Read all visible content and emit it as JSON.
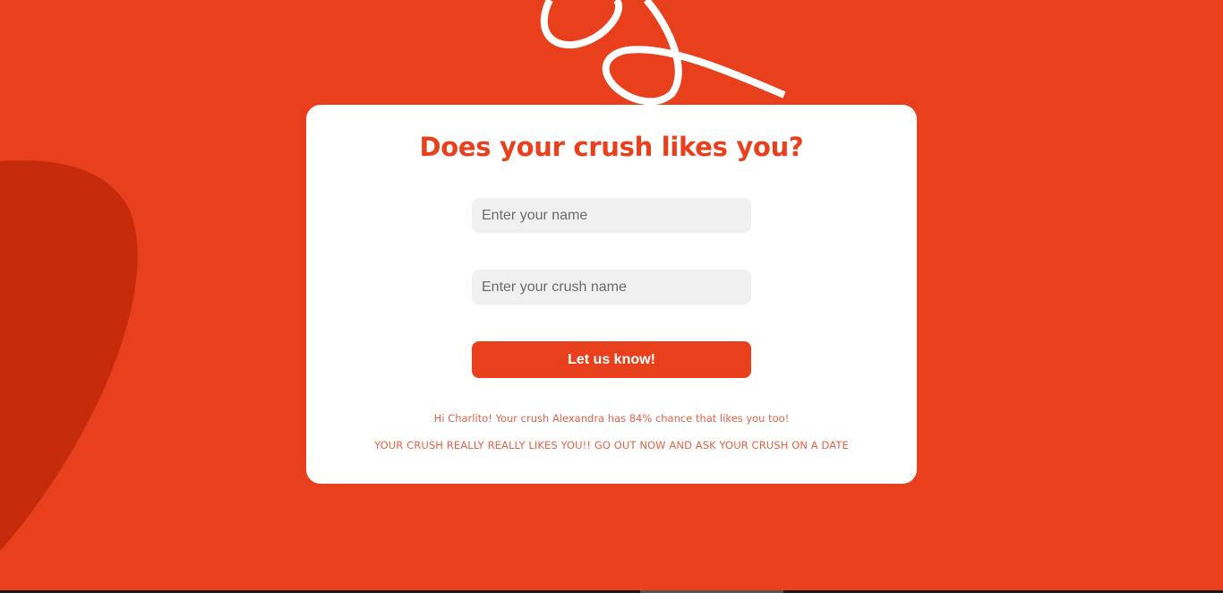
{
  "page": {
    "background_color": "#e8401c",
    "accent_color": "#e8401c",
    "blob_color": "#c52b0b"
  },
  "card": {
    "title": "Does your crush likes you?",
    "name_input": {
      "value": "",
      "placeholder": "Enter your name"
    },
    "crush_input": {
      "value": "",
      "placeholder": "Enter your crush name"
    },
    "submit_label": "Let us know!",
    "result_line": "Hi Charlito! Your crush Alexandra has 84% chance that likes you too!",
    "verdict_line": "YOUR CRUSH REALLY REALLY LIKES YOU!! GO OUT NOW AND ASK YOUR CRUSH ON A DATE"
  },
  "decorations": {
    "left_shape": "blob-shape",
    "top_scribble": "scribble-line-icon"
  }
}
